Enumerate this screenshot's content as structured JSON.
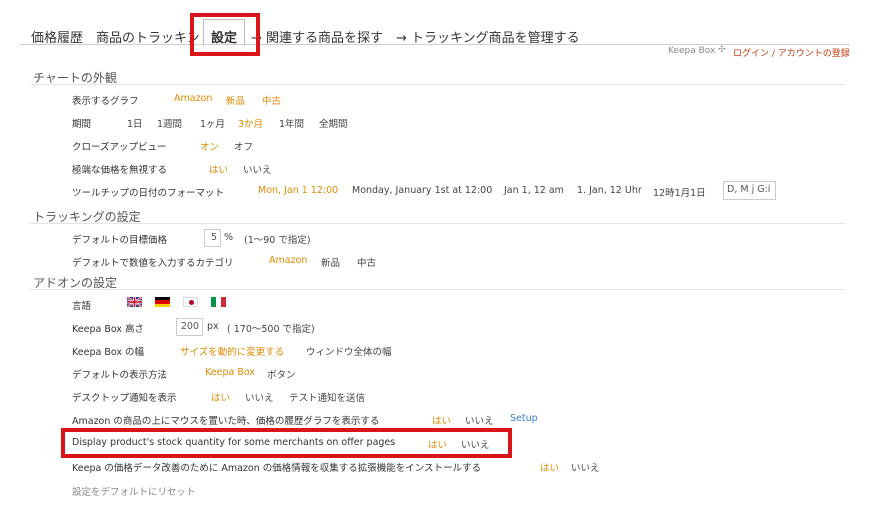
{
  "tabs": {
    "history": "価格履歴",
    "tracking": "商品のトラッキング",
    "settings": "設定",
    "related": "→ 関連する商品を探す",
    "manage": "→ トラッキング商品を管理する"
  },
  "header": {
    "brand": "Keepa Box",
    "login": "ログイン / アカウントの登録"
  },
  "sections": {
    "chart": {
      "title": "チャートの外観",
      "graph": {
        "label": "表示するグラフ",
        "options": [
          "Amazon",
          "新品",
          "中古"
        ]
      },
      "period": {
        "label": "期間",
        "options": [
          "1日",
          "1週間",
          "1ヶ月",
          "3か月",
          "1年間",
          "全期間"
        ]
      },
      "closeup": {
        "label": "クローズアップビュー",
        "options": [
          "オン",
          "オフ"
        ]
      },
      "extreme": {
        "label": "極端な価格を無視する",
        "options": [
          "はい",
          "いいえ"
        ]
      },
      "tooltip": {
        "label": "ツールチップの日付のフォーマット",
        "options": [
          "Mon, Jan 1 12:00",
          "Monday, January 1st at 12:00",
          "Jan 1, 12 am",
          "1. Jan, 12 Uhr",
          "12時1月1日"
        ],
        "custom": "D, M j G:i"
      }
    },
    "tracking": {
      "title": "トラッキングの設定",
      "target": {
        "label": "デフォルトの目標価格",
        "value": "5",
        "unit": "%",
        "hint": "(1〜90 で指定)"
      },
      "category": {
        "label": "デフォルトで数値を入力するカテゴリ",
        "options": [
          "Amazon",
          "新品",
          "中古"
        ]
      }
    },
    "addon": {
      "title": "アドオンの設定",
      "language": {
        "label": "言語"
      },
      "height": {
        "label": "Keepa Box 高さ",
        "value": "200",
        "unit": "px",
        "hint": "( 170〜500 で指定)"
      },
      "width": {
        "label": "Keepa Box の幅",
        "options": [
          "サイズを動的に変更する",
          "ウィンドウ全体の幅"
        ]
      },
      "display": {
        "label": "デフォルトの表示方法",
        "options": [
          "Keepa Box",
          "ボタン"
        ]
      },
      "desktop": {
        "label": "デスクトップ通知を表示",
        "options": [
          "はい",
          "いいえ",
          "テスト通知を送信"
        ]
      },
      "hover": {
        "label": "Amazon の商品の上にマウスを置いた時、価格の履歴グラフを表示する",
        "options": [
          "はい",
          "いいえ"
        ],
        "setup": "Setup"
      },
      "stock": {
        "label": "Display product's stock quantity for some merchants on offer pages",
        "options": [
          "はい",
          "いいえ"
        ]
      },
      "collect": {
        "label": "Keepa の価格データ改善のために Amazon の価格情報を収集する拡張機能をインストールする",
        "options": [
          "はい",
          "いいえ"
        ]
      },
      "reset": "設定をデフォルトにリセット"
    }
  },
  "colors": {
    "selected": "#e08a00",
    "highlight": "#d9151b",
    "login": "#c83b0f",
    "setup": "#3a7bd5"
  }
}
